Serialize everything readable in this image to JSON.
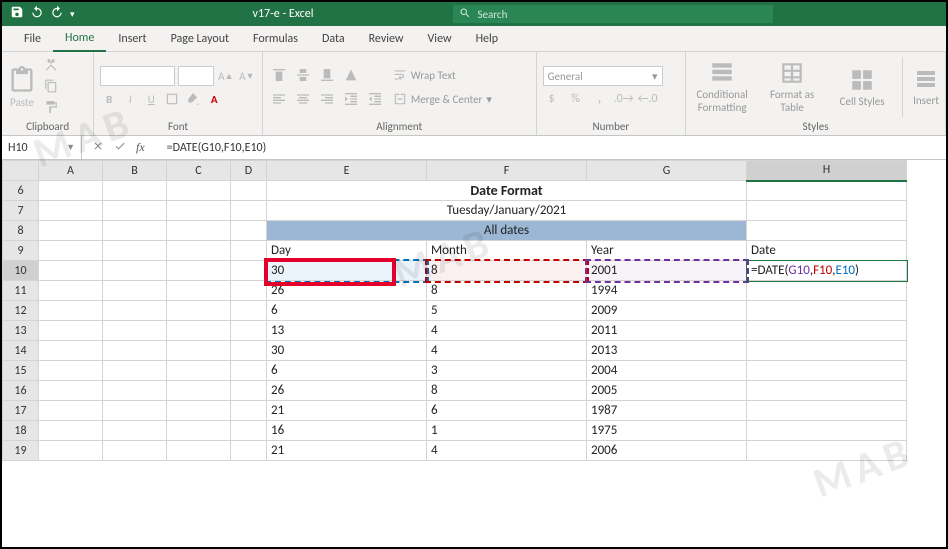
{
  "title": "v17-e  -  Excel",
  "search_placeholder": "Search",
  "tabs": [
    "File",
    "Home",
    "Insert",
    "Page Layout",
    "Formulas",
    "Data",
    "Review",
    "View",
    "Help"
  ],
  "active_tab": "Home",
  "ribbon": {
    "clipboard": {
      "label": "Clipboard",
      "paste": "Paste"
    },
    "font": {
      "label": "Font"
    },
    "alignment": {
      "label": "Alignment",
      "wrap": "Wrap Text",
      "merge": "Merge & Center"
    },
    "number": {
      "label": "Number",
      "format": "General"
    },
    "styles": {
      "label": "Styles",
      "cond": "Conditional Formatting",
      "fmt_table": "Format as Table",
      "cell_styles": "Cell Styles",
      "insert": "Insert"
    }
  },
  "namebox": "H10",
  "formula": "=DATE(G10,F10,E10)",
  "columns": [
    "A",
    "B",
    "C",
    "D",
    "E",
    "F",
    "G",
    "H"
  ],
  "rows": [
    6,
    7,
    8,
    9,
    10,
    11,
    12,
    13,
    14,
    15,
    16,
    17,
    18,
    19
  ],
  "sheet": {
    "title_text": "Date Format",
    "date_display": "Tuesday/January/2021",
    "all_dates": "All dates",
    "headers": {
      "day": "Day",
      "month": "Month",
      "year": "Year",
      "date": "Date"
    },
    "h10_formula_display": {
      "pre": "=DATE(",
      "g": "G10",
      "c1": ",",
      "f": "F10",
      "c2": ",",
      "e": "E10",
      "post": ")"
    },
    "data": [
      {
        "day": "30",
        "month": "8",
        "year": "2001"
      },
      {
        "day": "26",
        "month": "8",
        "year": "1994"
      },
      {
        "day": "6",
        "month": "5",
        "year": "2009"
      },
      {
        "day": "13",
        "month": "4",
        "year": "2011"
      },
      {
        "day": "30",
        "month": "4",
        "year": "2013"
      },
      {
        "day": "6",
        "month": "3",
        "year": "2004"
      },
      {
        "day": "26",
        "month": "8",
        "year": "2005"
      },
      {
        "day": "21",
        "month": "6",
        "year": "1987"
      },
      {
        "day": "16",
        "month": "1",
        "year": "1975"
      },
      {
        "day": "21",
        "month": "4",
        "year": "2006"
      }
    ]
  },
  "watermark": "MAB"
}
